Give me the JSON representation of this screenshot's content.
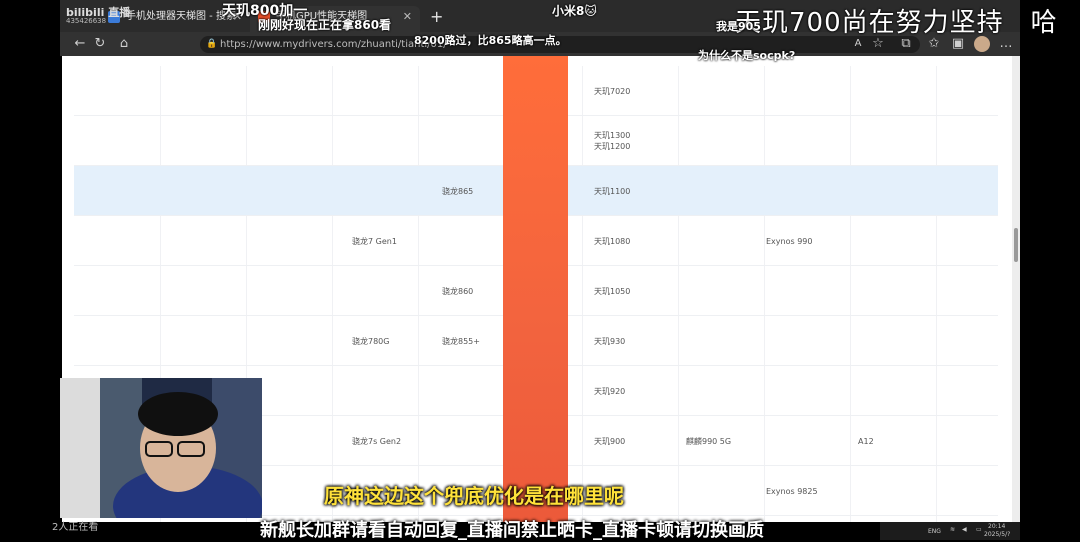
{
  "stream": {
    "logo": "bilibili 直播",
    "room_id": "435426638",
    "big_title": "天玑700尚在努力坚持　哈",
    "subtitle": "原神这边这个兜底优化是在哪里呢",
    "notice": "新舰长加群请看自动回复_直播间禁止晒卡_直播卡顿请切换画质",
    "watchers": "2人正在看"
  },
  "danmaku": [
    {
      "id": "d1",
      "text": "天玑800加一"
    },
    {
      "id": "d2",
      "text": "刚刚好现在正在拿860看"
    },
    {
      "id": "d3",
      "text": "小米8🐱"
    },
    {
      "id": "d4",
      "text": "我是905"
    },
    {
      "id": "d5",
      "text": "8200路过，比865略高一点。"
    },
    {
      "id": "d6",
      "text": "为什么不是socpk?"
    }
  ],
  "browser": {
    "tabs": [
      {
        "label": "手机处理器天梯图 - 搜索",
        "active": false
      },
      {
        "label": "手机GPU性能天梯图",
        "active": true
      }
    ],
    "new_tab": "+",
    "url": "https://www.mydrivers.com/zhuanti/tianti/01/"
  },
  "table": {
    "rows": [
      {
        "cells": [
          {
            "col": 8,
            "text": "天玑7020"
          }
        ]
      },
      {
        "cells": [
          {
            "col": 8,
            "text": "天玑1300\n天玑1200"
          }
        ]
      },
      {
        "highlight": true,
        "cells": [
          {
            "col": 5,
            "text": "骁龙865"
          },
          {
            "col": 8,
            "text": "天玑1100"
          }
        ]
      },
      {
        "cells": [
          {
            "col": 4,
            "text": "骁龙7 Gen1"
          },
          {
            "col": 8,
            "text": "天玑1080"
          },
          {
            "col": 10,
            "text": "Exynos 990"
          }
        ]
      },
      {
        "cells": [
          {
            "col": 5,
            "text": "骁龙860"
          },
          {
            "col": 8,
            "text": "天玑1050"
          }
        ]
      },
      {
        "cells": [
          {
            "col": 4,
            "text": "骁龙780G"
          },
          {
            "col": 5,
            "text": "骁龙855+"
          },
          {
            "col": 8,
            "text": "天玑930"
          }
        ]
      },
      {
        "cells": [
          {
            "col": 8,
            "text": "天玑920"
          }
        ]
      },
      {
        "cells": [
          {
            "col": 4,
            "text": "骁龙7s Gen2"
          },
          {
            "col": 8,
            "text": "天玑900"
          },
          {
            "col": 9,
            "text": "麒麟990 5G"
          },
          {
            "col": 11,
            "text": "A12"
          }
        ]
      },
      {
        "cells": [
          {
            "col": 10,
            "text": "Exynos 9825"
          }
        ]
      }
    ]
  },
  "taskbar": {
    "lang": "ENG",
    "time": "20:14",
    "date": "2025/5/?"
  }
}
